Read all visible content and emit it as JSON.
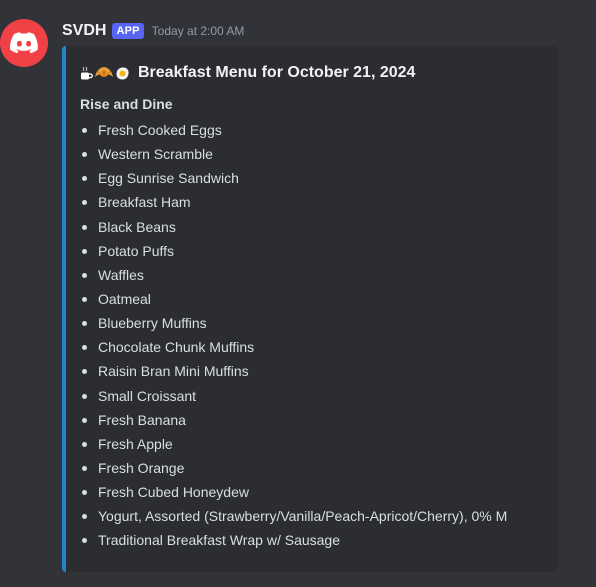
{
  "message": {
    "username": "SVDH",
    "badge": "APP",
    "timestamp": "Today at 2:00 AM",
    "avatar_icon": "discord-logo-icon",
    "avatar_color": "#ef4146"
  },
  "embed": {
    "accent_color": "#1e88c9",
    "emoji_icons": [
      "coffee-icon",
      "croissant-icon",
      "fried-egg-icon"
    ],
    "title": "Breakfast Menu for October 21, 2024",
    "section_heading": "Rise and Dine",
    "items": [
      "Fresh Cooked Eggs",
      "Western Scramble",
      "Egg Sunrise Sandwich",
      "Breakfast Ham",
      "Black Beans",
      "Potato Puffs",
      "Waffles",
      "Oatmeal",
      "Blueberry Muffins",
      "Chocolate Chunk Muffins",
      "Raisin Bran Mini Muffins",
      "Small Croissant",
      "Fresh Banana",
      "Fresh Apple",
      "Fresh Orange",
      "Fresh Cubed Honeydew",
      "Yogurt, Assorted (Strawberry/Vanilla/Peach-Apricot/Cherry), 0% M",
      "Traditional Breakfast Wrap w/ Sausage"
    ]
  }
}
